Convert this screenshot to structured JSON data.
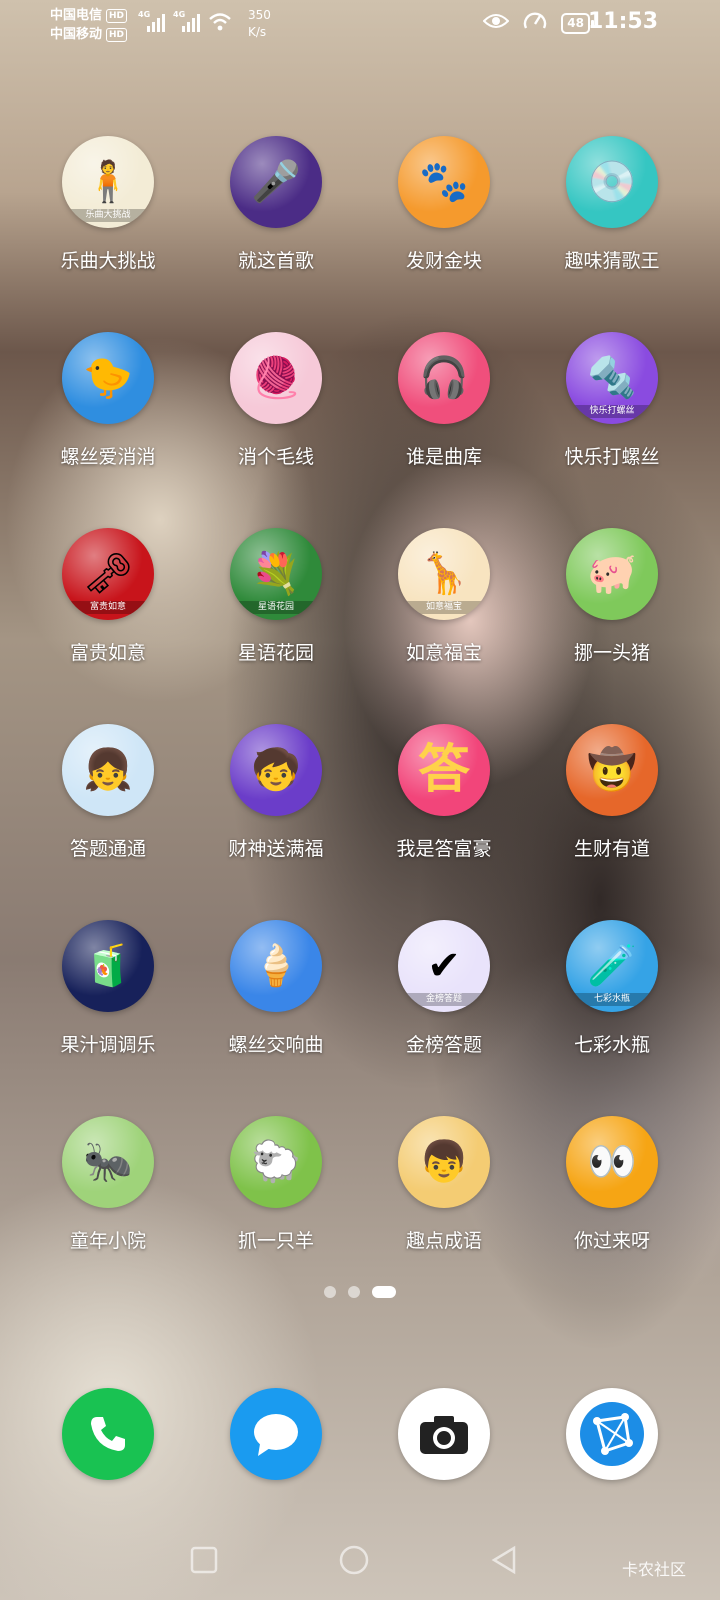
{
  "status_bar": {
    "carrier_1": "中国电信",
    "carrier_2": "中国移动",
    "hd_badge": "HD",
    "network_1": "4G",
    "network_2": "4G",
    "speed_value": "350",
    "speed_unit": "K/s",
    "battery": "48",
    "time": "11:53"
  },
  "apps": [
    {
      "label": "乐曲大挑战",
      "icon": "music-challenge-icon",
      "bg": "#f3ecd6",
      "glyph": "🧍",
      "ribbon": "乐曲大挑战"
    },
    {
      "label": "就这首歌",
      "icon": "microphone-icon",
      "bg": "#4b2c86",
      "glyph": "🎤",
      "ribbon": ""
    },
    {
      "label": "发财金块",
      "icon": "gold-block-icon",
      "bg": "#f59a2d",
      "glyph": "🐾",
      "ribbon": ""
    },
    {
      "label": "趣味猜歌王",
      "icon": "record-player-icon",
      "bg": "#35c6c2",
      "glyph": "💿",
      "ribbon": ""
    },
    {
      "label": "螺丝爱消消",
      "icon": "yellow-duck-icon",
      "bg": "#2f8ee0",
      "glyph": "🐤",
      "ribbon": ""
    },
    {
      "label": "消个毛线",
      "icon": "yarn-girl-icon",
      "bg": "#f6c9d8",
      "glyph": "🧶",
      "ribbon": ""
    },
    {
      "label": "谁是曲库",
      "icon": "singer-girl-icon",
      "bg": "#f04f7c",
      "glyph": "🎧",
      "ribbon": ""
    },
    {
      "label": "快乐打螺丝",
      "icon": "screw-box-icon",
      "bg": "#8a4be0",
      "glyph": "🔩",
      "ribbon": "快乐打螺丝"
    },
    {
      "label": "富贵如意",
      "icon": "ruyi-scepter-icon",
      "bg": "#c8141b",
      "glyph": "🗝",
      "ribbon": "富贵如意"
    },
    {
      "label": "星语花园",
      "icon": "flower-garden-icon",
      "bg": "#2f8a3a",
      "glyph": "💐",
      "ribbon": "星语花园"
    },
    {
      "label": "如意福宝",
      "icon": "giraffe-icon",
      "bg": "#f8e4c0",
      "glyph": "🦒",
      "ribbon": "如意福宝"
    },
    {
      "label": "挪一头猪",
      "icon": "pig-icon",
      "bg": "#7fc95b",
      "glyph": "🐖",
      "ribbon": ""
    },
    {
      "label": "答题通通",
      "icon": "headphone-girl-icon",
      "bg": "#cfe6f7",
      "glyph": "👧",
      "ribbon": ""
    },
    {
      "label": "财神送满福",
      "icon": "fortune-god-icon",
      "bg": "#6b3dc9",
      "glyph": "🧒",
      "ribbon": ""
    },
    {
      "label": "我是答富豪",
      "icon": "answer-character-icon",
      "bg": "#f2457a",
      "glyph": "答",
      "ribbon": ""
    },
    {
      "label": "生财有道",
      "icon": "rich-man-icon",
      "bg": "#e6672a",
      "glyph": "🤠",
      "ribbon": ""
    },
    {
      "label": "果汁调调乐",
      "icon": "juice-bottles-icon",
      "bg": "#17215a",
      "glyph": "🧃",
      "ribbon": ""
    },
    {
      "label": "螺丝交响曲",
      "icon": "ice-cream-screw-icon",
      "bg": "#3a86e8",
      "glyph": "🍦",
      "ribbon": ""
    },
    {
      "label": "金榜答题",
      "icon": "quiz-book-icon",
      "bg": "#e9e3fb",
      "glyph": "✔",
      "ribbon": "金榜答题"
    },
    {
      "label": "七彩水瓶",
      "icon": "green-bottle-icon",
      "bg": "#35a3e6",
      "glyph": "🧪",
      "ribbon": "七彩水瓶"
    },
    {
      "label": "童年小院",
      "icon": "anteater-icon",
      "bg": "#9fd37a",
      "glyph": "🐜",
      "ribbon": ""
    },
    {
      "label": "抓一只羊",
      "icon": "sheep-icon",
      "bg": "#7fc24a",
      "glyph": "🐑",
      "ribbon": ""
    },
    {
      "label": "趣点成语",
      "icon": "scholar-boy-icon",
      "bg": "#f4cc73",
      "glyph": "👦",
      "ribbon": ""
    },
    {
      "label": "你过来呀",
      "icon": "blue-blob-icon",
      "bg": "#f6a514",
      "glyph": "👀",
      "ribbon": ""
    }
  ],
  "dock": [
    {
      "icon": "phone-icon",
      "bg": "#19c252"
    },
    {
      "icon": "messages-icon",
      "bg": "#1a9bf0"
    },
    {
      "icon": "camera-icon",
      "bg": "#ffffff"
    },
    {
      "icon": "browser-icon",
      "bg": "#ffffff"
    }
  ],
  "page_indicator": {
    "pages": 3,
    "active": 3
  },
  "watermark": "卡农社区"
}
